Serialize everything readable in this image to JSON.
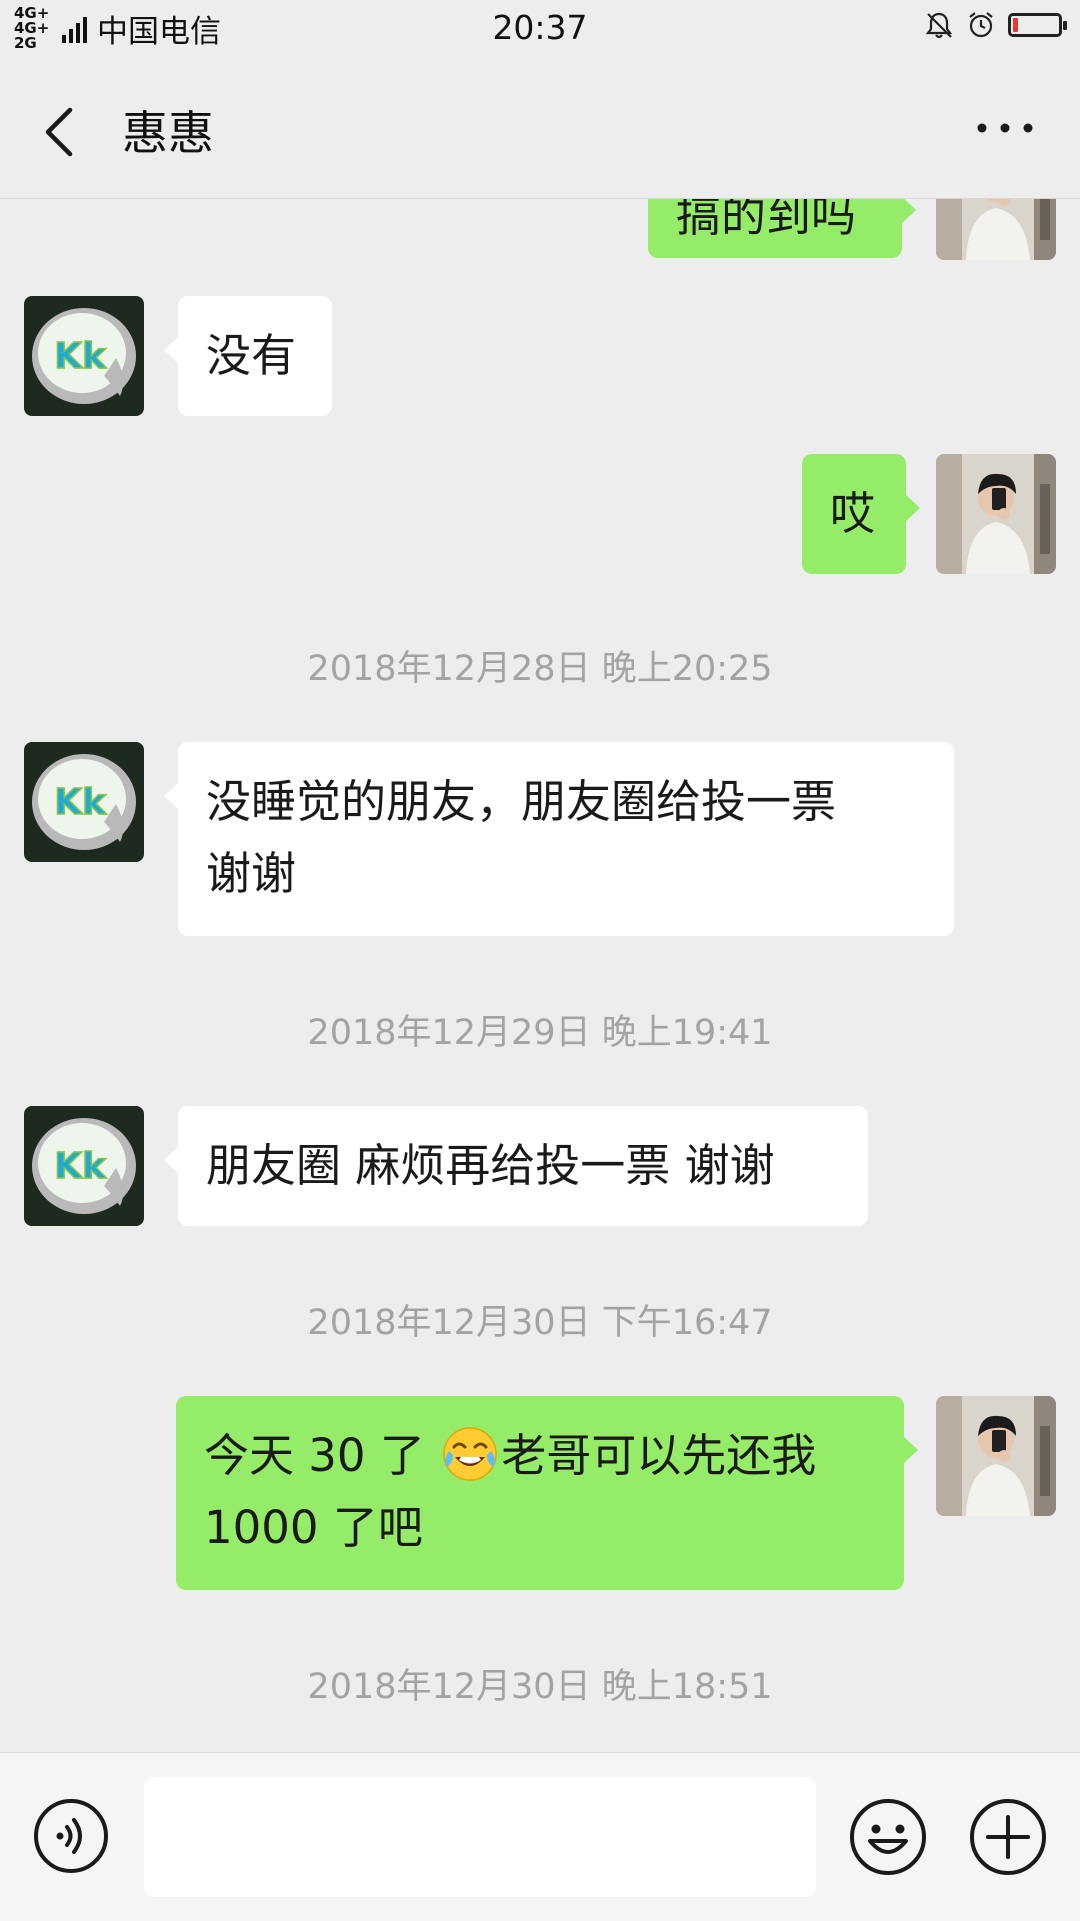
{
  "status_bar": {
    "network": "4G+ 4G+ 2G",
    "carrier": "中国电信",
    "time": "20:37",
    "battery_level": 0.12,
    "battery_color": "#e53935",
    "icons": [
      "mute-bell-icon",
      "alarm-clock-icon",
      "battery-icon"
    ]
  },
  "header": {
    "title": "惠惠",
    "back_icon": "chevron-left-icon",
    "more_icon": "more-dots-icon"
  },
  "messages": [
    {
      "side": "right",
      "type": "text",
      "text": "搞的到吗",
      "avatar": "my-avatar"
    },
    {
      "side": "left",
      "type": "text",
      "text": "没有",
      "avatar": "contact-avatar-kk"
    },
    {
      "side": "right",
      "type": "text",
      "text": "哎",
      "avatar": "my-avatar"
    },
    {
      "type": "timestamp",
      "text": "2018年12月28日 晚上20:25"
    },
    {
      "side": "left",
      "type": "text",
      "line1": "没睡觉的朋友，朋友圈给投一票",
      "line2": "谢谢",
      "avatar": "contact-avatar-kk"
    },
    {
      "type": "timestamp",
      "text": "2018年12月29日 晚上19:41"
    },
    {
      "side": "left",
      "type": "text",
      "text": "朋友圈 麻烦再给投一票 谢谢",
      "avatar": "contact-avatar-kk"
    },
    {
      "type": "timestamp",
      "text": "2018年12月30日 下午16:47"
    },
    {
      "side": "right",
      "type": "text",
      "part1": "今天 30 了 ",
      "emoji": "tears-of-joy-emoji",
      "part2": "老哥可以先还我",
      "line2": "1000 了吧",
      "avatar": "my-avatar"
    },
    {
      "type": "timestamp",
      "text": "2018年12月30日 晚上18:51"
    }
  ],
  "input_bar": {
    "value": "",
    "icons": [
      "voice-icon",
      "emoji-icon",
      "plus-icon"
    ]
  },
  "colors": {
    "background": "#ededed",
    "bubble_sent": "#95ec69",
    "bubble_received": "#ffffff",
    "timestamp": "#a3a3a3"
  }
}
